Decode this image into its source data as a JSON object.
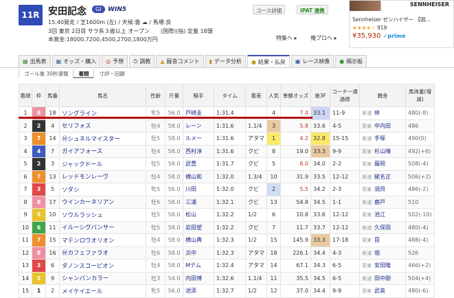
{
  "race": {
    "number": "11R",
    "name": "安田記念",
    "grade": "GI",
    "win5": "WIN5",
    "line1": "15:40発走 / 芝1600m (左) / 天候:曇 ☁ / 馬場:良",
    "line2": "3回 東京 2日目 サラ系３歳以上 オープン　　(国際)(指) 定量 18頭",
    "line3": "本賞金:18000,7200,4500,2700,1800万円"
  },
  "buttons": {
    "course": "コース詳細",
    "ipat": "IPAT 連携",
    "special": "特集へ ▸",
    "pro": "俺プロへ ▸"
  },
  "ad": {
    "brand": "SENNHEISER",
    "title": "Sennheiser ゼンハイザー 【国...",
    "stars": "★★★★☆",
    "reviews": "919",
    "price": "¥35,930",
    "prime": "✓prime"
  },
  "tabs": [
    {
      "label": "出馬表",
      "icon": "▦"
    },
    {
      "label": "オッズ・購入",
      "icon": "▦"
    },
    {
      "label": "予想",
      "icon": "◎"
    },
    {
      "label": "調教",
      "icon": "⏱"
    },
    {
      "label": "厩舎コメント",
      "icon": "▲"
    },
    {
      "label": "データ分析",
      "icon": "▮"
    },
    {
      "label": "結果・払戻",
      "icon": "●"
    },
    {
      "label": "レース映像",
      "icon": "▣"
    },
    {
      "label": "掲示板",
      "icon": "●"
    }
  ],
  "subtabs": [
    "ゴール後 30秒速報",
    "着順",
    "寸評・回顧"
  ],
  "headers": [
    "着順",
    "枠",
    "馬番",
    "馬名",
    "性齢",
    "斤量",
    "騎手",
    "タイム",
    "着差",
    "人気",
    "単勝オッズ",
    "後3F",
    "コーナー通過順",
    "厩舎",
    "馬体重(増減)"
  ],
  "frame_colors": {
    "1": "#ffffff",
    "2": "#333333",
    "3": "#e04848",
    "4": "#3f5bbf",
    "5": "#e8c22a",
    "6": "#3fa44a",
    "7": "#ee8f2c",
    "8": "#f08fa0"
  },
  "rows": [
    [
      "1",
      "8",
      "18",
      "ソングライン",
      "牝5",
      "56.0",
      "戸崎圭",
      "1:31.4",
      "",
      "4",
      "7.4",
      "33.1",
      "11-9",
      "美浦",
      "林",
      "480(-8)"
    ],
    [
      "2",
      "2",
      "4",
      "セリフォス",
      "牡4",
      "58.0",
      "レーン",
      "1:31.6",
      "1.1/4",
      "3",
      "5.8",
      "33.6",
      "4-5",
      "栗東",
      "中内田",
      "486"
    ],
    [
      "3",
      "7",
      "14",
      "Ⓜシュネルマイスター",
      "牡5",
      "58.0",
      "ルメー",
      "1:31.6",
      "アタマ",
      "1",
      "4.2",
      "32.8",
      "15-15",
      "美浦",
      "手塚",
      "490(0)"
    ],
    [
      "4",
      "4",
      "7",
      "ガイアフォース",
      "牡4",
      "58.0",
      "西村淳",
      "1:31.6",
      "クビ",
      "8",
      "19.0",
      "33.3",
      "9-9",
      "栗東",
      "杉山晴",
      "492(+6)"
    ],
    [
      "5",
      "2",
      "3",
      "ジャックドール",
      "牡5",
      "58.0",
      "武豊",
      "1:31.7",
      "クビ",
      "5",
      "8.0",
      "34.0",
      "2-2",
      "栗東",
      "藤岡",
      "508(-4)"
    ],
    [
      "6",
      "7",
      "13",
      "レッドモンレーヴ",
      "牡4",
      "58.0",
      "横山和",
      "1:32.0",
      "1.3/4",
      "10",
      "31.9",
      "33.5",
      "12-12",
      "美浦",
      "蛯名正",
      "506(+2)"
    ],
    [
      "7",
      "3",
      "5",
      "ソダシ",
      "牝5",
      "56.0",
      "川田",
      "1:32.0",
      "クビ",
      "2",
      "5.5",
      "34.2",
      "2-3",
      "栗東",
      "須貝",
      "486(-2)"
    ],
    [
      "8",
      "8",
      "17",
      "ウインカーネリアン",
      "牡6",
      "58.0",
      "三浦",
      "1:32.1",
      "クビ",
      "13",
      "54.8",
      "34.5",
      "1-1",
      "美浦",
      "鹿戸",
      "510"
    ],
    [
      "9",
      "5",
      "10",
      "ソウルラッシュ",
      "牡5",
      "58.0",
      "松山",
      "1:32.2",
      "1/2",
      "6",
      "10.8",
      "33.6",
      "12-12",
      "栗東",
      "池江",
      "502(-10)"
    ],
    [
      "10",
      "6",
      "11",
      "イルーシヴパンサー",
      "牡5",
      "58.0",
      "岩田望",
      "1:32.2",
      "クビ",
      "7",
      "11.7",
      "33.7",
      "12-12",
      "美浦",
      "久保田",
      "480(-4)"
    ],
    [
      "11",
      "7",
      "15",
      "マテンロウオリオン",
      "牡4",
      "58.0",
      "横山典",
      "1:32.3",
      "1/2",
      "15",
      "145.9",
      "33.3",
      "17-18",
      "栗東",
      "昆",
      "488(-4)"
    ],
    [
      "12",
      "8",
      "16",
      "Ⓜカフェファラオ",
      "牡6",
      "58.0",
      "浜中",
      "1:32.3",
      "アタマ",
      "18",
      "226.1",
      "34.4",
      "4-3",
      "美浦",
      "堀",
      "526"
    ],
    [
      "13",
      "3",
      "6",
      "ダノンスコーピオン",
      "牡4",
      "58.0",
      "Mデム",
      "1:32.4",
      "アタマ",
      "14",
      "67.1",
      "34.3",
      "6-5",
      "栗東",
      "安田隆",
      "466(+2)"
    ],
    [
      "14",
      "5",
      "9",
      "シャンパンカラー",
      "牡3",
      "54.0",
      "内田博",
      "1:32.6",
      "1.1/4",
      "11",
      "35.5",
      "34.5",
      "6-5",
      "美浦",
      "田中剛",
      "504(+4)"
    ],
    [
      "15",
      "1",
      "2",
      "メイケイエール",
      "牝5",
      "56.0",
      "池添",
      "1:32.7",
      "1/2",
      "12",
      "37.0",
      "34.4",
      "9-9",
      "栗東",
      "武英",
      "480(-6)"
    ]
  ],
  "highlights": {
    "pop1": "#fbe96a",
    "pop2": "#cfdcf5",
    "pop3": "#e8c9a0",
    "f3_1": "#fbe96a",
    "f3_2": "#cfd6f5",
    "f3_3": "#e8c9a0"
  }
}
